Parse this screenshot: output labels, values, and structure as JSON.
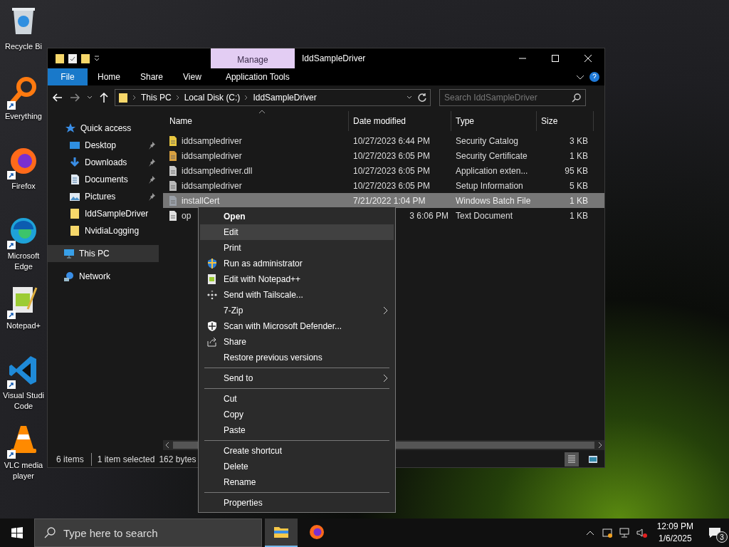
{
  "desktop_icons": [
    {
      "label": "Recycle Bi"
    },
    {
      "label": "Everything"
    },
    {
      "label": "Firefox"
    },
    {
      "label": "Microsoft Edge"
    },
    {
      "label": "Notepad+"
    },
    {
      "label": "Visual Studi Code"
    },
    {
      "label": "VLC media player"
    }
  ],
  "window": {
    "title": "IddSampleDriver",
    "context_tab": "Manage",
    "tabs": [
      {
        "label": "File",
        "selected": true
      },
      {
        "label": "Home",
        "selected": false
      },
      {
        "label": "Share",
        "selected": false
      },
      {
        "label": "View",
        "selected": false
      },
      {
        "label": "Application Tools",
        "selected": false
      }
    ],
    "breadcrumb": [
      "This PC",
      "Local Disk (C:)",
      "IddSampleDriver"
    ],
    "search": {
      "placeholder": "Search IddSampleDriver"
    },
    "nav": [
      {
        "label": "Quick access",
        "selected": false,
        "children": [
          {
            "label": "Desktop",
            "pinned": true,
            "selected": false
          },
          {
            "label": "Downloads",
            "pinned": true,
            "selected": false
          },
          {
            "label": "Documents",
            "pinned": true,
            "selected": false
          },
          {
            "label": "Pictures",
            "pinned": true,
            "selected": false
          },
          {
            "label": "IddSampleDriver",
            "pinned": false,
            "selected": false
          },
          {
            "label": "NvidiaLogging",
            "pinned": false,
            "selected": false
          }
        ]
      },
      {
        "label": "This PC",
        "selected": true
      },
      {
        "label": "Network",
        "selected": false
      }
    ],
    "columns": [
      "Name",
      "Date modified",
      "Type",
      "Size"
    ],
    "rows": [
      {
        "name": "iddsampledriver",
        "date": "10/27/2023 6:44 PM",
        "type": "Security Catalog",
        "size": "3 KB",
        "selected": false
      },
      {
        "name": "iddsampledriver",
        "date": "10/27/2023 6:05 PM",
        "type": "Security Certificate",
        "size": "1 KB",
        "selected": false
      },
      {
        "name": "iddsampledriver.dll",
        "date": "10/27/2023 6:05 PM",
        "type": "Application exten...",
        "size": "95 KB",
        "selected": false
      },
      {
        "name": "iddsampledriver",
        "date": "10/27/2023 6:05 PM",
        "type": "Setup Information",
        "size": "5 KB",
        "selected": false
      },
      {
        "name": "installCert",
        "date": "7/21/2022 1:04 PM",
        "type": "Windows Batch File",
        "size": "1 KB",
        "selected": true
      },
      {
        "name": "op",
        "date": "3 6:06 PM",
        "type": "Text Document",
        "size": "1 KB",
        "selected": false,
        "date_cut": true
      }
    ],
    "status": {
      "count": "6 items",
      "selection": "1 item selected",
      "size": "162 bytes"
    },
    "view": [
      {
        "kind": "details",
        "selected": true
      },
      {
        "kind": "large",
        "selected": false
      }
    ]
  },
  "context_menu": [
    [
      {
        "label": "Open",
        "default": true,
        "selected": false
      },
      {
        "label": "Edit",
        "selected": true
      },
      {
        "label": "Print",
        "selected": false
      },
      {
        "label": "Run as administrator",
        "selected": false
      },
      {
        "label": "Edit with Notepad++",
        "selected": false
      },
      {
        "label": "Send with Tailscale...",
        "selected": false
      },
      {
        "label": "7-Zip",
        "submenu": true,
        "selected": false
      },
      {
        "label": "Scan with Microsoft Defender...",
        "selected": false
      },
      {
        "label": "Share",
        "selected": false
      },
      {
        "label": "Restore previous versions",
        "selected": false
      }
    ],
    [
      {
        "label": "Send to",
        "submenu": true,
        "selected": false
      }
    ],
    [
      {
        "label": "Cut",
        "selected": false
      },
      {
        "label": "Copy",
        "selected": false
      },
      {
        "label": "Paste",
        "selected": false
      }
    ],
    [
      {
        "label": "Create shortcut",
        "selected": false
      },
      {
        "label": "Delete",
        "selected": false
      },
      {
        "label": "Rename",
        "selected": false
      }
    ],
    [
      {
        "label": "Properties",
        "selected": false
      }
    ]
  ],
  "taskbar": {
    "search": {
      "placeholder": "Type here to search"
    },
    "apps": [
      {
        "selected": true
      },
      {
        "selected": false
      }
    ],
    "time": "12:09 PM",
    "date": "1/6/2025",
    "notifications": "3"
  }
}
